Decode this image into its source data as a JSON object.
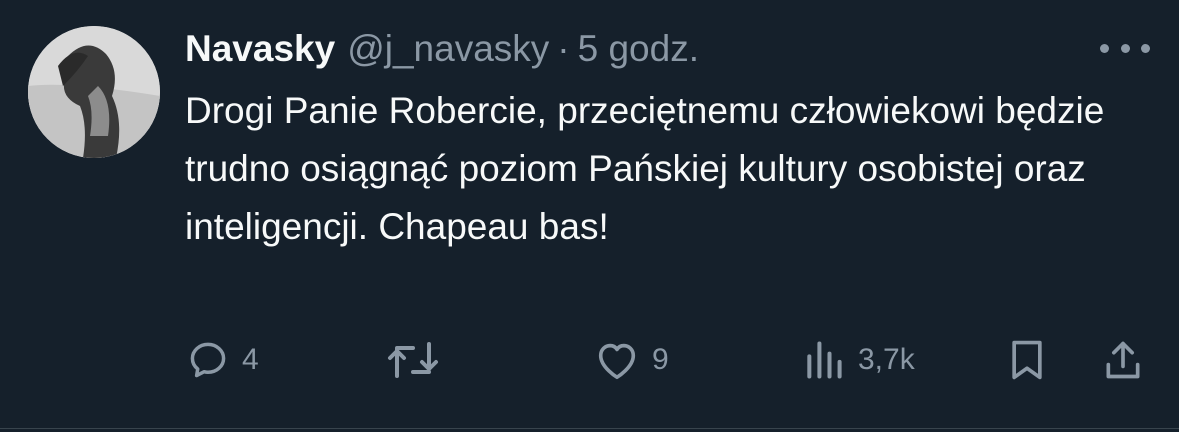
{
  "tweet": {
    "display_name": "Navasky",
    "handle": "@j_navasky",
    "separator": "·",
    "time": "5 godz.",
    "text": "Drogi Panie Robercie, przeciętnemu człowiekowi będzie trudno osiągnąć poziom Pańskiej kultury osobistej oraz inteligencji. Chapeau bas!"
  },
  "actions": {
    "replies": "4",
    "retweets": "",
    "likes": "9",
    "views": "3,7k"
  },
  "icons": {
    "reply": "reply-icon",
    "retweet": "retweet-icon",
    "like": "heart-icon",
    "views": "views-icon",
    "bookmark": "bookmark-icon",
    "share": "share-icon",
    "more": "more-icon"
  },
  "colors": {
    "background": "#15202b",
    "text": "#f7f9f9",
    "secondary": "#8b98a5"
  }
}
